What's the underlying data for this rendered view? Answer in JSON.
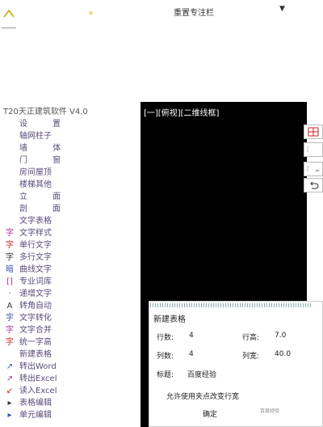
{
  "top_bar": {
    "combo_label": "重置专注栏",
    "arrow_glyph": "▼",
    "dot_glyph": "✳"
  },
  "panel": {
    "title": "T20天正建筑软件 V4.0",
    "items": [
      {
        "glyph": "",
        "label": "设 置",
        "spaced": true
      },
      {
        "glyph": "",
        "label": "轴网柱子"
      },
      {
        "glyph": "",
        "label": "墙 体",
        "spaced": true
      },
      {
        "glyph": "",
        "label": "门 窗",
        "spaced": true
      },
      {
        "glyph": "",
        "label": "房间屋顶"
      },
      {
        "glyph": "",
        "label": "楼梯其他"
      },
      {
        "glyph": "",
        "label": "立 面",
        "spaced": true
      },
      {
        "glyph": "",
        "label": "剖 面",
        "spaced": true
      },
      {
        "glyph": "",
        "label": "文字表格"
      },
      {
        "glyph": "字",
        "label": "文字样式"
      },
      {
        "glyph": "字",
        "label": "单行文字"
      },
      {
        "glyph": "字",
        "label": "多行文字"
      },
      {
        "glyph": "暗",
        "label": "曲线文字"
      },
      {
        "glyph": "[]",
        "label": "专业词库"
      },
      {
        "glyph": "·",
        "label": "递增文字"
      },
      {
        "glyph": "A",
        "label": "转角自动"
      },
      {
        "glyph": "字",
        "label": "文字转化"
      },
      {
        "glyph": "字",
        "label": "文字合并"
      },
      {
        "glyph": "字",
        "label": "统一字高"
      },
      {
        "glyph": "",
        "label": "新建表格"
      },
      {
        "glyph": "↗",
        "label": "转出Word"
      },
      {
        "glyph": "↗",
        "label": "转出Excel"
      },
      {
        "glyph": "↙",
        "label": "读入Excel"
      },
      {
        "glyph": "▸",
        "label": "表格编辑"
      },
      {
        "glyph": "▸",
        "label": "单元编辑"
      }
    ]
  },
  "viewport": {
    "label": "[一][俯视][二维线框]"
  },
  "dialog": {
    "title": "新建表格",
    "rows_label": "行数:",
    "rows_value": "4",
    "row_height_label": "行高:",
    "row_height_value": "7.0",
    "cols_label": "列数:",
    "cols_value": "4",
    "col_width_label": "列宽:",
    "col_width_value": "40.0",
    "heading_label": "标题:",
    "heading_value": "百度经验",
    "allow_label": "允许使用夹点改变行宽",
    "ok_label": "确定",
    "watermark": "百度经验"
  },
  "colors": {
    "menu_text": "#5a4a7a",
    "viewport_bg": "#000000",
    "icon_red": "#cc2222",
    "icon_blue": "#3355aa",
    "icon_magenta": "#b0309a"
  }
}
